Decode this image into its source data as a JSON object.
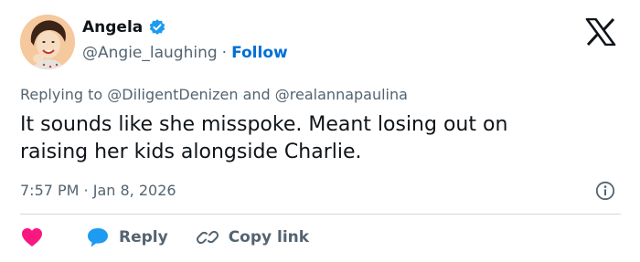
{
  "author": {
    "display_name": "Angela",
    "handle": "@Angie_laughing",
    "separator": "·",
    "follow_label": "Follow",
    "verified": true
  },
  "reply_context": {
    "prefix": "Replying to",
    "mention_1": "@DiligentDenizen",
    "conjunction": "and",
    "mention_2": "@realannapaulina"
  },
  "tweet": {
    "line_1": "It sounds like she misspoke. Meant losing out on",
    "line_2": "raising her kids alongside Charlie.",
    "timestamp": "7:57 PM · Jan 8, 2026"
  },
  "actions": {
    "like_icon": "heart-icon",
    "reply_label": "Reply",
    "reply_icon": "speech-bubble-icon",
    "copy_label": "Copy link",
    "copy_icon": "link-icon",
    "info_icon": "info-icon"
  },
  "colors": {
    "text_primary": "#0f1419",
    "text_secondary": "#536471",
    "follow_blue": "#006fd6",
    "verified_blue": "#1d9bf0",
    "like_red": "#f91880",
    "divider": "#cfd9de"
  }
}
